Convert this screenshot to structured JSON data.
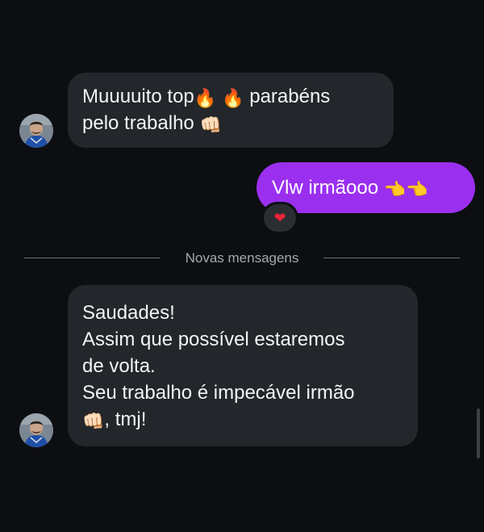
{
  "messages": [
    {
      "sender": "other",
      "lines": [
        {
          "text": "Muuuuito top",
          "emoji_after": "🔥 🔥",
          "text_after": " parabéns"
        },
        {
          "text": "pelo trabalho",
          "emoji_after": "👊🏻"
        }
      ]
    },
    {
      "sender": "me",
      "text": "Vlw irmãooo",
      "emoji_after": "👈👈",
      "reaction": "❤"
    },
    {
      "sender": "other",
      "lines": [
        {
          "text": "Saudades!"
        },
        {
          "text": "Assim que possível estaremos"
        },
        {
          "text": "de volta."
        },
        {
          "text": "Seu trabalho é impecável irmão"
        },
        {
          "emoji_before": "👊🏻",
          "text": ", tmj!"
        }
      ]
    }
  ],
  "divider": {
    "label": "Novas mensagens"
  },
  "icons": {
    "fire": "fire-icon",
    "fist": "oncoming-fist-icon",
    "pointing": "backhand-index-pointing-left-icon",
    "heart": "heart-reaction-icon"
  },
  "colors": {
    "background": "#0c0e11",
    "received_bubble": "#23262b",
    "sent_bubble": "#9b2ff0",
    "reaction_heart": "#e8233a"
  }
}
